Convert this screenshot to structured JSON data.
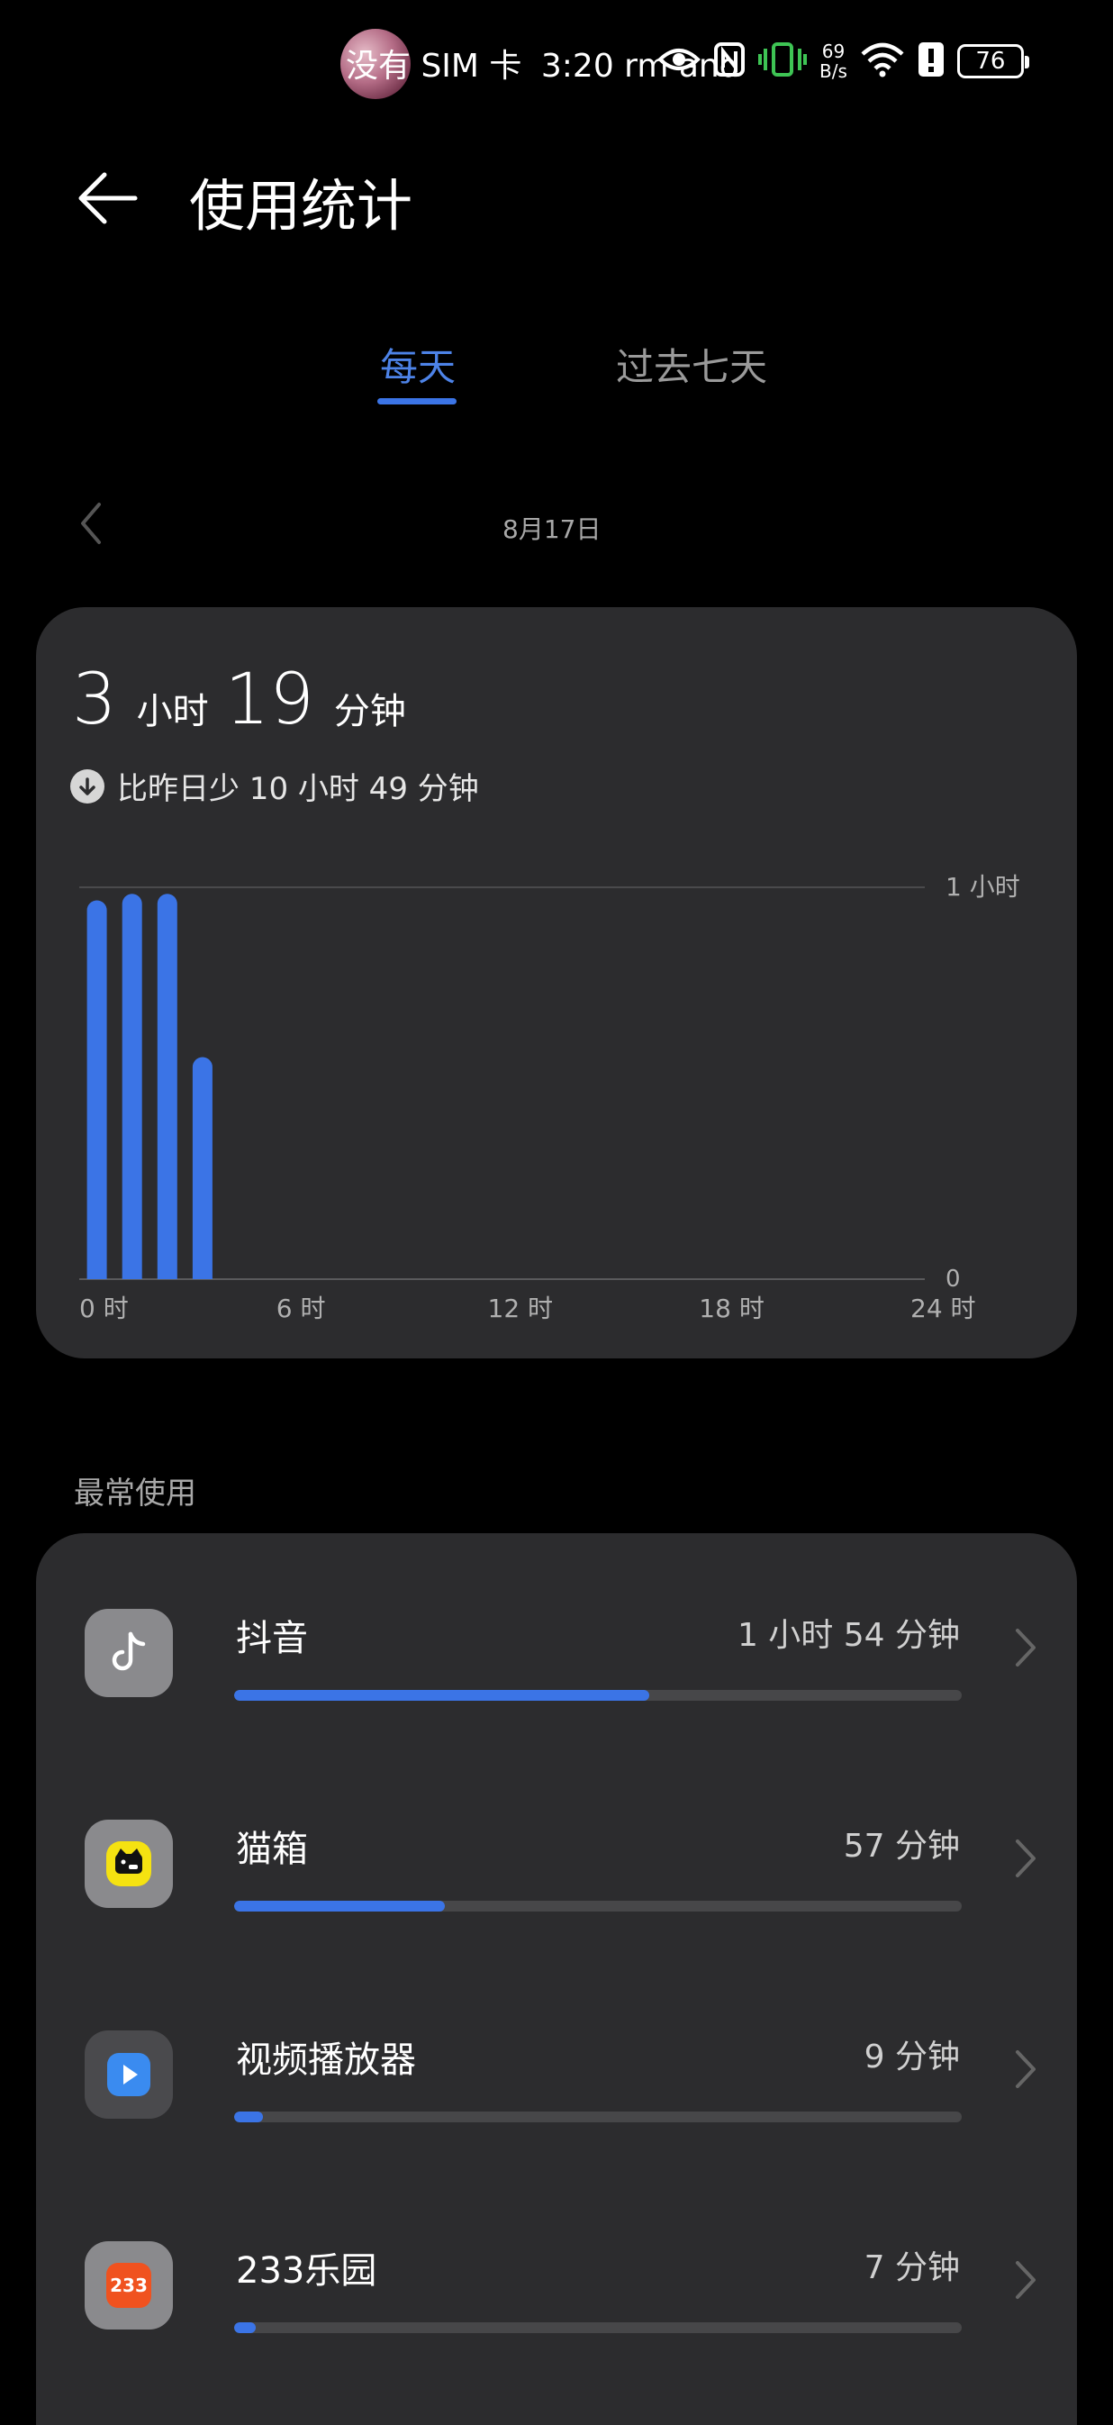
{
  "status_bar": {
    "avatar": "avatar-photo",
    "carrier_text": "没有 SIM 卡",
    "overlay_text": "3:20 rm and",
    "net_speed_value": "69",
    "net_speed_unit": "B/s",
    "battery": "76",
    "icons": [
      "eye-icon",
      "nfc-icon",
      "vibrate-icon",
      "wifi-icon",
      "alert-icon",
      "battery-icon"
    ]
  },
  "header": {
    "title": "使用统计",
    "back_icon": "back-arrow-icon"
  },
  "tabs": [
    {
      "label": "每天",
      "active": true
    },
    {
      "label": "过去七天",
      "active": false
    }
  ],
  "date_nav": {
    "date": "8月17日",
    "prev_icon": "chevron-left-icon"
  },
  "summary": {
    "hours": "3",
    "hours_unit": "小时",
    "minutes": "19",
    "minutes_unit": "分钟",
    "comparison": "比昨日少 10 小时 49 分钟",
    "comparison_icon": "arrow-down-icon"
  },
  "chart_data": {
    "type": "bar",
    "y_top_label": "1 小时",
    "y_bottom_label": "0",
    "x_tick_labels": [
      "0 时",
      "6 时",
      "12 时",
      "18 时",
      "24 时"
    ],
    "bar_color": "#3b74e6",
    "ylim": [
      0,
      60
    ],
    "unit": "分钟",
    "hours": [
      0,
      1,
      2,
      3
    ],
    "values": [
      58,
      59,
      59,
      34
    ]
  },
  "most_used": {
    "title": "最常使用",
    "apps": [
      {
        "name": "抖音",
        "time": "1 小时 54 分钟",
        "progress": 0.57,
        "icon": "douyin-icon"
      },
      {
        "name": "猫箱",
        "time": "57 分钟",
        "progress": 0.29,
        "icon": "maoxiang-icon"
      },
      {
        "name": "视频播放器",
        "time": "9 分钟",
        "progress": 0.04,
        "icon": "video-player-icon"
      },
      {
        "name": "233乐园",
        "time": "7 分钟",
        "progress": 0.03,
        "icon": "233-icon",
        "icon_text": "233"
      }
    ]
  },
  "colors": {
    "accent": "#3b74e6",
    "card": "#2c2c2e",
    "background": "#000000"
  }
}
